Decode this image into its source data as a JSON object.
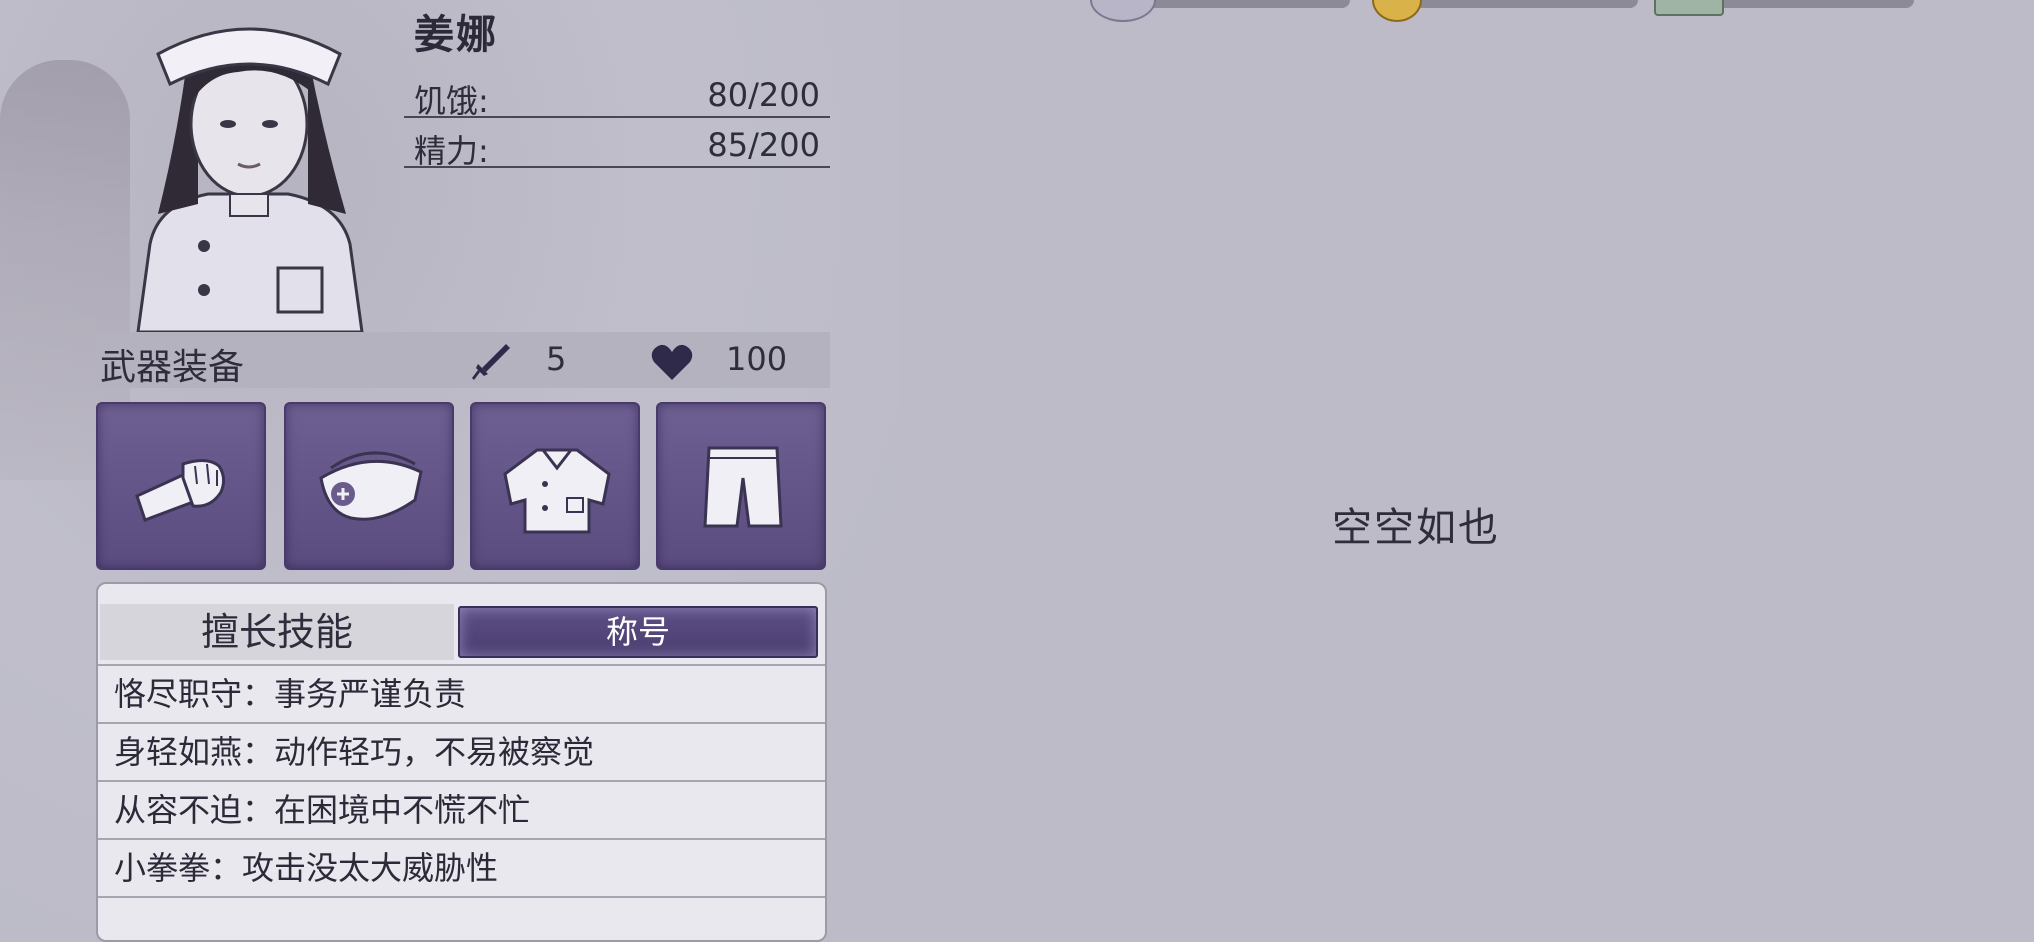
{
  "character": {
    "name": "姜娜",
    "stats": [
      {
        "label": "饥饿:",
        "value": "80/200"
      },
      {
        "label": "精力:",
        "value": "85/200"
      }
    ]
  },
  "equipment": {
    "title": "武器装备",
    "attack": "5",
    "health": "100",
    "slots": [
      "fist-icon",
      "nurse-cap-icon",
      "nurse-shirt-icon",
      "shorts-icon"
    ]
  },
  "tabs": {
    "skills": "擅长技能",
    "title": "称号",
    "active": "title"
  },
  "skills": [
    "恪尽职守：事务严谨负责",
    "身轻如燕：动作轻巧，不易被察觉",
    "从容不迫：在困境中不慌不忙",
    "小拳拳：攻击没太大威胁性"
  ],
  "inventory": {
    "empty_text": "空空如也"
  },
  "colors": {
    "background": "#bcbbc7",
    "slot": "#5b4c80",
    "active_tab": "#4a3d70"
  }
}
